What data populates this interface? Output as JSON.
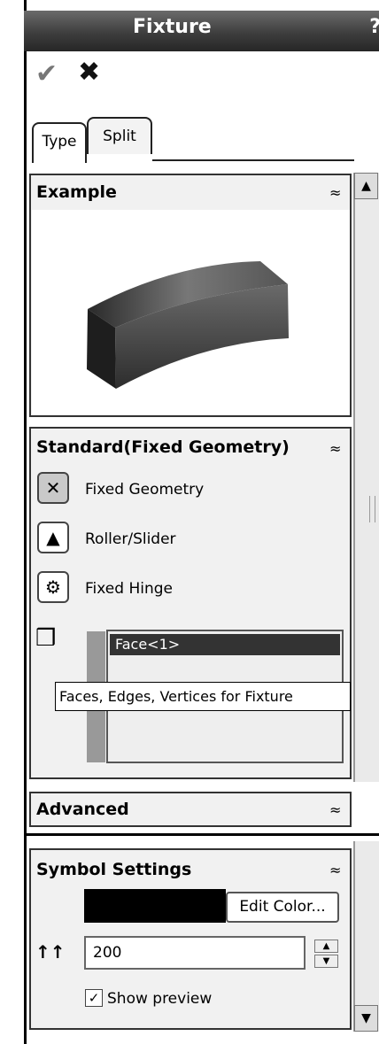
{
  "title": "Fixture",
  "help_label": "?",
  "toolbar": {
    "ok_icon": "✔",
    "cancel_icon": "✖"
  },
  "tabs": [
    {
      "label": "Type"
    },
    {
      "label": "Split"
    }
  ],
  "sections": {
    "example": {
      "title": "Example",
      "chevron": "≈"
    },
    "standard": {
      "title": "Standard(Fixed Geometry)",
      "chevron": "≈",
      "options": [
        {
          "label": "Fixed Geometry",
          "icon": "fixed-geometry-icon",
          "selected": true
        },
        {
          "label": "Roller/Slider",
          "icon": "roller-slider-icon",
          "selected": false
        },
        {
          "label": "Fixed Hinge",
          "icon": "fixed-hinge-icon",
          "selected": false
        }
      ],
      "selection_list": [
        "Face<1>"
      ],
      "tooltip": "Faces, Edges, Vertices for Fixture"
    },
    "advanced": {
      "title": "Advanced",
      "chevron": "≈"
    },
    "symbol": {
      "title": "Symbol Settings",
      "chevron": "≈",
      "color": "#000000",
      "edit_color_label": "Edit Color...",
      "size_value": "200",
      "show_preview_label": "Show preview",
      "show_preview_checked": true
    }
  },
  "colors": {
    "title_bar": "#3e3e3e",
    "selection": "#333333"
  }
}
